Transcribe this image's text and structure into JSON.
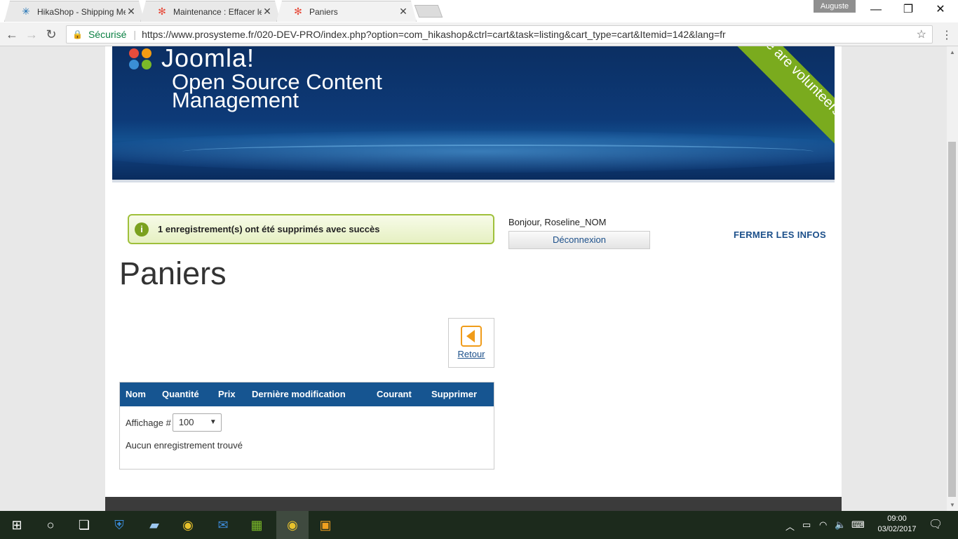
{
  "browser": {
    "tabs": [
      {
        "title": "HikaShop - Shipping Me",
        "icon": "hikashop-icon",
        "active": false
      },
      {
        "title": "Maintenance : Effacer le",
        "icon": "joomla-icon",
        "active": false
      },
      {
        "title": "Paniers",
        "icon": "joomla-icon",
        "active": true
      }
    ],
    "profile": "Auguste",
    "secure_label": "Sécurisé",
    "url": "https://www.prosysteme.fr/020-DEV-PRO/index.php?option=com_hikashop&ctrl=cart&task=listing&cart_type=cart&Itemid=142&lang=fr"
  },
  "banner": {
    "logo": "Joomla!",
    "tagline_line1": "Open Source Content",
    "tagline_line2": "Management",
    "ribbon": "We are volunteers !"
  },
  "message": "1 enregistrement(s) ont été supprimés avec succès",
  "user": {
    "greeting": "Bonjour, Roseline_NOM",
    "logout": "Déconnexion",
    "close_info": "FERMER LES INFOS"
  },
  "page": {
    "title": "Paniers",
    "back_label": "Retour"
  },
  "table": {
    "columns": [
      "Nom",
      "Quantité",
      "Prix",
      "Dernière modification",
      "Courant",
      "Supprimer"
    ],
    "display_label": "Affichage #",
    "display_value": "100",
    "empty_text": "Aucun enregistrement trouvé"
  },
  "taskbar": {
    "time": "09:00",
    "date": "03/02/2017"
  }
}
